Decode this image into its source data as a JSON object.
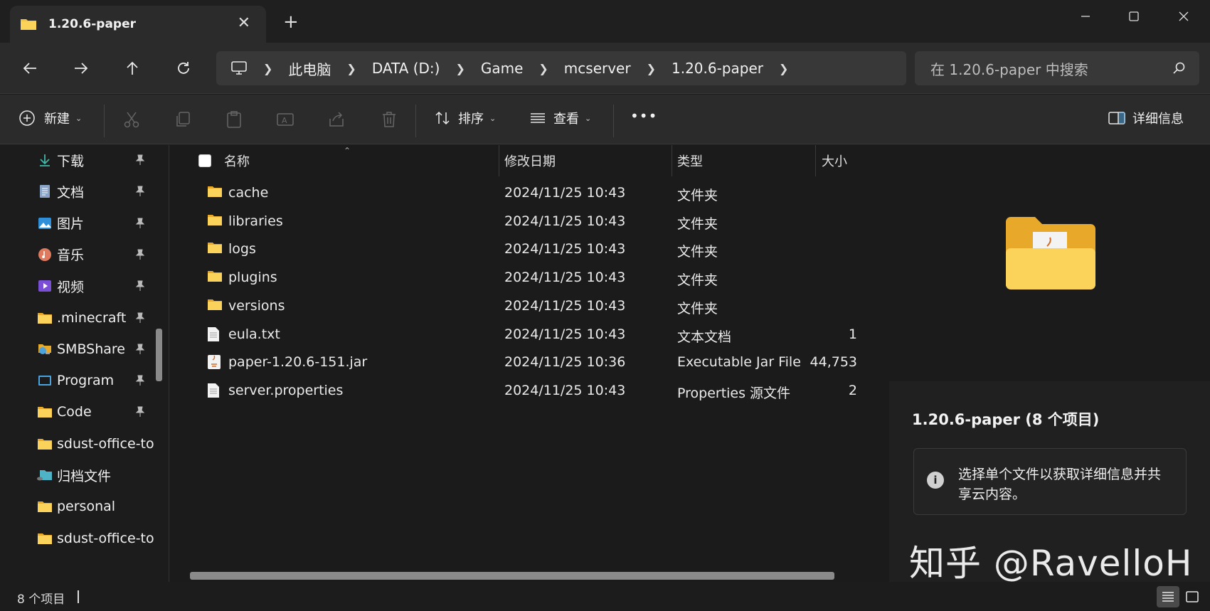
{
  "window": {
    "tab_title": "1.20.6-paper",
    "new_tab_label": "+",
    "close_tab_label": "✕"
  },
  "nav": {
    "breadcrumbs": [
      "此电脑",
      "DATA (D:)",
      "Game",
      "mcserver",
      "1.20.6-paper"
    ],
    "search_placeholder": "在 1.20.6-paper 中搜索"
  },
  "toolbar": {
    "new_label": "新建",
    "sort_label": "排序",
    "view_label": "查看",
    "more_label": "•••",
    "details_label": "详细信息"
  },
  "sidebar": {
    "items": [
      {
        "label": "下载",
        "icon": "download-icon",
        "pinned": true
      },
      {
        "label": "文档",
        "icon": "document-icon",
        "pinned": true
      },
      {
        "label": "图片",
        "icon": "pictures-icon",
        "pinned": true
      },
      {
        "label": "音乐",
        "icon": "music-icon",
        "pinned": true
      },
      {
        "label": "视频",
        "icon": "video-icon",
        "pinned": true
      },
      {
        "label": ".minecraft",
        "icon": "folder-icon",
        "pinned": true
      },
      {
        "label": "SMBShare",
        "icon": "network-folder-icon",
        "pinned": true
      },
      {
        "label": "Program",
        "icon": "program-icon",
        "pinned": true
      },
      {
        "label": "Code",
        "icon": "folder-icon",
        "pinned": true
      },
      {
        "label": "sdust-office-to",
        "icon": "folder-icon",
        "pinned": false
      },
      {
        "label": "归档文件",
        "icon": "cloud-folder-icon",
        "pinned": false
      },
      {
        "label": "personal",
        "icon": "folder-icon",
        "pinned": false
      },
      {
        "label": "sdust-office-to",
        "icon": "folder-icon",
        "pinned": false
      }
    ]
  },
  "table": {
    "headers": {
      "name": "名称",
      "modified": "修改日期",
      "type": "类型",
      "size": "大小"
    },
    "rows": [
      {
        "name": "cache",
        "modified": "2024/11/25 10:43",
        "type": "文件夹",
        "size": "",
        "icon": "folder-icon"
      },
      {
        "name": "libraries",
        "modified": "2024/11/25 10:43",
        "type": "文件夹",
        "size": "",
        "icon": "folder-icon"
      },
      {
        "name": "logs",
        "modified": "2024/11/25 10:43",
        "type": "文件夹",
        "size": "",
        "icon": "folder-icon"
      },
      {
        "name": "plugins",
        "modified": "2024/11/25 10:43",
        "type": "文件夹",
        "size": "",
        "icon": "folder-icon"
      },
      {
        "name": "versions",
        "modified": "2024/11/25 10:43",
        "type": "文件夹",
        "size": "",
        "icon": "folder-icon"
      },
      {
        "name": "eula.txt",
        "modified": "2024/11/25 10:43",
        "type": "文本文档",
        "size": "1",
        "icon": "text-file-icon"
      },
      {
        "name": "paper-1.20.6-151.jar",
        "modified": "2024/11/25 10:36",
        "type": "Executable Jar File",
        "size": "44,753",
        "icon": "jar-file-icon"
      },
      {
        "name": "server.properties",
        "modified": "2024/11/25 10:43",
        "type": "Properties 源文件",
        "size": "2",
        "icon": "text-file-icon"
      }
    ]
  },
  "details": {
    "title": "1.20.6-paper (8 个项目)",
    "info": "选择单个文件以获取详细信息并共享云内容。",
    "info_icon_label": "i",
    "watermark": "知乎 @RavelloH"
  },
  "status": {
    "item_count": "8 个项目"
  },
  "colors": {
    "folder_yellow": "#f5c542",
    "background": "#1b1b1b",
    "toolbar": "#2b2b2b"
  }
}
